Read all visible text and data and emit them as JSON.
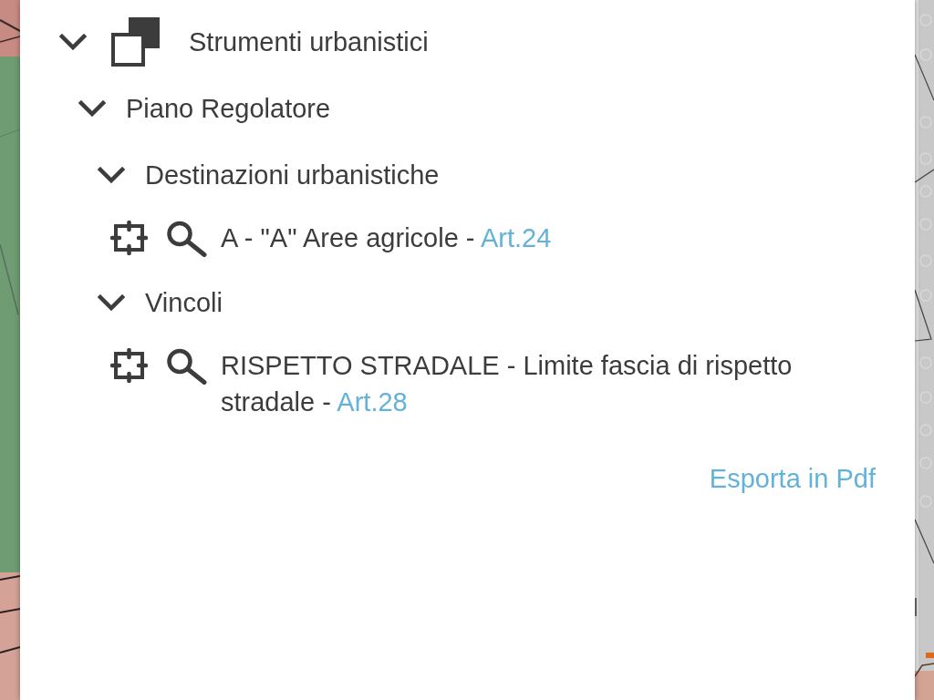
{
  "tree": [
    {
      "kind": "category",
      "label": "Strumenti urbanistici",
      "expanded": true,
      "children": [
        {
          "kind": "group",
          "label": "Piano Regolatore",
          "expanded": true,
          "children": [
            {
              "kind": "group",
              "label": "Destinazioni urbanistiche",
              "expanded": true,
              "children": [
                {
                  "kind": "layer",
                  "label": "A - \"A\" Aree agricole -",
                  "link": "Art.24"
                }
              ]
            },
            {
              "kind": "group",
              "label": "Vincoli",
              "expanded": true,
              "children": [
                {
                  "kind": "layer",
                  "label": "RISPETTO STRADALE - Limite fascia di rispetto stradale -",
                  "link": "Art.28"
                }
              ]
            }
          ]
        }
      ]
    }
  ],
  "export_link": "Esporta in Pdf"
}
